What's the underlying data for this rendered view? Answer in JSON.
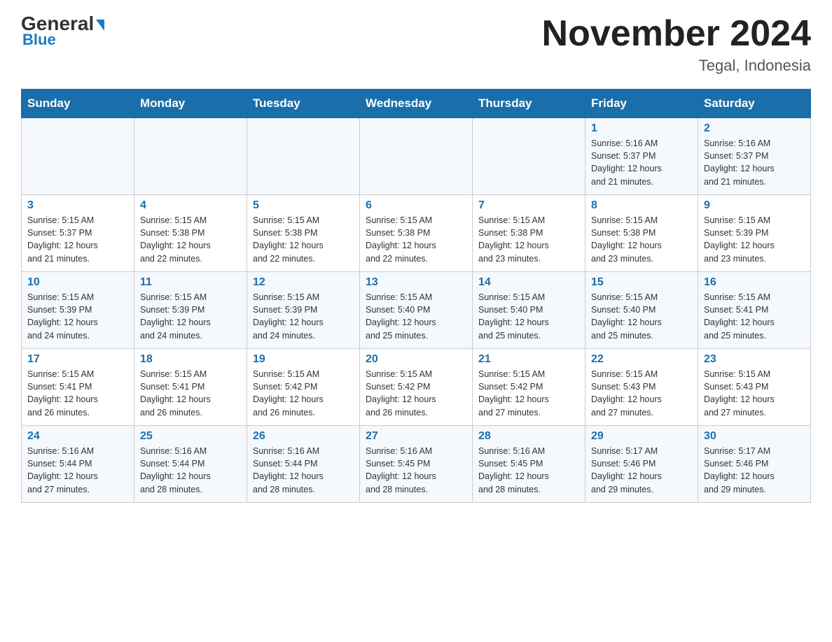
{
  "header": {
    "logo_top": "General",
    "logo_bottom": "Blue",
    "month_title": "November 2024",
    "location": "Tegal, Indonesia"
  },
  "days_of_week": [
    "Sunday",
    "Monday",
    "Tuesday",
    "Wednesday",
    "Thursday",
    "Friday",
    "Saturday"
  ],
  "weeks": [
    [
      {
        "day": "",
        "info": ""
      },
      {
        "day": "",
        "info": ""
      },
      {
        "day": "",
        "info": ""
      },
      {
        "day": "",
        "info": ""
      },
      {
        "day": "",
        "info": ""
      },
      {
        "day": "1",
        "info": "Sunrise: 5:16 AM\nSunset: 5:37 PM\nDaylight: 12 hours\nand 21 minutes."
      },
      {
        "day": "2",
        "info": "Sunrise: 5:16 AM\nSunset: 5:37 PM\nDaylight: 12 hours\nand 21 minutes."
      }
    ],
    [
      {
        "day": "3",
        "info": "Sunrise: 5:15 AM\nSunset: 5:37 PM\nDaylight: 12 hours\nand 21 minutes."
      },
      {
        "day": "4",
        "info": "Sunrise: 5:15 AM\nSunset: 5:38 PM\nDaylight: 12 hours\nand 22 minutes."
      },
      {
        "day": "5",
        "info": "Sunrise: 5:15 AM\nSunset: 5:38 PM\nDaylight: 12 hours\nand 22 minutes."
      },
      {
        "day": "6",
        "info": "Sunrise: 5:15 AM\nSunset: 5:38 PM\nDaylight: 12 hours\nand 22 minutes."
      },
      {
        "day": "7",
        "info": "Sunrise: 5:15 AM\nSunset: 5:38 PM\nDaylight: 12 hours\nand 23 minutes."
      },
      {
        "day": "8",
        "info": "Sunrise: 5:15 AM\nSunset: 5:38 PM\nDaylight: 12 hours\nand 23 minutes."
      },
      {
        "day": "9",
        "info": "Sunrise: 5:15 AM\nSunset: 5:39 PM\nDaylight: 12 hours\nand 23 minutes."
      }
    ],
    [
      {
        "day": "10",
        "info": "Sunrise: 5:15 AM\nSunset: 5:39 PM\nDaylight: 12 hours\nand 24 minutes."
      },
      {
        "day": "11",
        "info": "Sunrise: 5:15 AM\nSunset: 5:39 PM\nDaylight: 12 hours\nand 24 minutes."
      },
      {
        "day": "12",
        "info": "Sunrise: 5:15 AM\nSunset: 5:39 PM\nDaylight: 12 hours\nand 24 minutes."
      },
      {
        "day": "13",
        "info": "Sunrise: 5:15 AM\nSunset: 5:40 PM\nDaylight: 12 hours\nand 25 minutes."
      },
      {
        "day": "14",
        "info": "Sunrise: 5:15 AM\nSunset: 5:40 PM\nDaylight: 12 hours\nand 25 minutes."
      },
      {
        "day": "15",
        "info": "Sunrise: 5:15 AM\nSunset: 5:40 PM\nDaylight: 12 hours\nand 25 minutes."
      },
      {
        "day": "16",
        "info": "Sunrise: 5:15 AM\nSunset: 5:41 PM\nDaylight: 12 hours\nand 25 minutes."
      }
    ],
    [
      {
        "day": "17",
        "info": "Sunrise: 5:15 AM\nSunset: 5:41 PM\nDaylight: 12 hours\nand 26 minutes."
      },
      {
        "day": "18",
        "info": "Sunrise: 5:15 AM\nSunset: 5:41 PM\nDaylight: 12 hours\nand 26 minutes."
      },
      {
        "day": "19",
        "info": "Sunrise: 5:15 AM\nSunset: 5:42 PM\nDaylight: 12 hours\nand 26 minutes."
      },
      {
        "day": "20",
        "info": "Sunrise: 5:15 AM\nSunset: 5:42 PM\nDaylight: 12 hours\nand 26 minutes."
      },
      {
        "day": "21",
        "info": "Sunrise: 5:15 AM\nSunset: 5:42 PM\nDaylight: 12 hours\nand 27 minutes."
      },
      {
        "day": "22",
        "info": "Sunrise: 5:15 AM\nSunset: 5:43 PM\nDaylight: 12 hours\nand 27 minutes."
      },
      {
        "day": "23",
        "info": "Sunrise: 5:15 AM\nSunset: 5:43 PM\nDaylight: 12 hours\nand 27 minutes."
      }
    ],
    [
      {
        "day": "24",
        "info": "Sunrise: 5:16 AM\nSunset: 5:44 PM\nDaylight: 12 hours\nand 27 minutes."
      },
      {
        "day": "25",
        "info": "Sunrise: 5:16 AM\nSunset: 5:44 PM\nDaylight: 12 hours\nand 28 minutes."
      },
      {
        "day": "26",
        "info": "Sunrise: 5:16 AM\nSunset: 5:44 PM\nDaylight: 12 hours\nand 28 minutes."
      },
      {
        "day": "27",
        "info": "Sunrise: 5:16 AM\nSunset: 5:45 PM\nDaylight: 12 hours\nand 28 minutes."
      },
      {
        "day": "28",
        "info": "Sunrise: 5:16 AM\nSunset: 5:45 PM\nDaylight: 12 hours\nand 28 minutes."
      },
      {
        "day": "29",
        "info": "Sunrise: 5:17 AM\nSunset: 5:46 PM\nDaylight: 12 hours\nand 29 minutes."
      },
      {
        "day": "30",
        "info": "Sunrise: 5:17 AM\nSunset: 5:46 PM\nDaylight: 12 hours\nand 29 minutes."
      }
    ]
  ]
}
